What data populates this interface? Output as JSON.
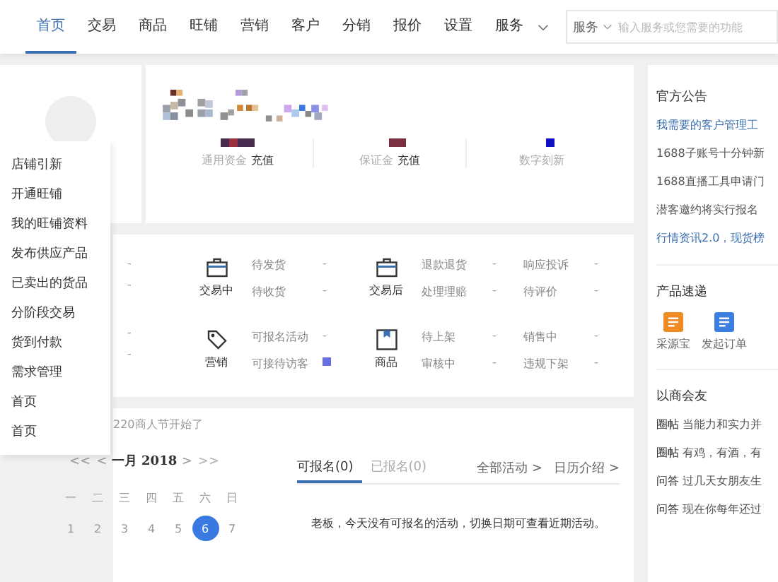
{
  "nav": {
    "items": [
      {
        "label": "首页",
        "selected": true
      },
      {
        "label": "交易",
        "selected": false
      },
      {
        "label": "商品",
        "selected": false
      },
      {
        "label": "旺铺",
        "selected": false
      },
      {
        "label": "营销",
        "selected": false
      },
      {
        "label": "客户",
        "selected": false
      },
      {
        "label": "分销",
        "selected": false
      },
      {
        "label": "报价",
        "selected": false
      },
      {
        "label": "设置",
        "selected": false
      },
      {
        "label": "服务",
        "selected": false
      }
    ],
    "search": {
      "scope": "服务",
      "placeholder": "输入服务或您需要的功能"
    }
  },
  "profile": {
    "funds": [
      {
        "label": "通用资金",
        "action": "充值"
      },
      {
        "label": "保证金",
        "action": "充值"
      },
      {
        "label": "数字刻新"
      }
    ]
  },
  "stats": {
    "groups": [
      {
        "kind": "bag",
        "title": "交易中",
        "items": [
          {
            "label": "待发货",
            "value": "-"
          },
          {
            "label": "待收货",
            "value": "-"
          }
        ]
      },
      {
        "kind": "bag",
        "title": "交易后",
        "items": [
          {
            "label": "退款退货",
            "value": "-"
          },
          {
            "label": "响应投诉",
            "value": "-"
          },
          {
            "label": "处理理赔",
            "value": "-"
          },
          {
            "label": "待评价",
            "value": "-"
          }
        ]
      },
      {
        "kind": "tag",
        "title": "营销",
        "items": [
          {
            "label": "可报名活动",
            "value": "-"
          },
          {
            "label": "可接待访客",
            "value": ""
          }
        ]
      },
      {
        "kind": "box",
        "title": "商品",
        "items": [
          {
            "label": "待上架",
            "value": "-"
          },
          {
            "label": "销售中",
            "value": "-"
          },
          {
            "label": "审核中",
            "value": "-"
          },
          {
            "label": "违规下架",
            "value": "-"
          }
        ]
      }
    ],
    "left_values": [
      "-",
      "-",
      "-",
      "-"
    ]
  },
  "dropdown": {
    "items": [
      "店铺引新",
      "开通旺铺",
      "我的旺铺资料",
      "发布供应产品",
      "已卖出的货品",
      "分阶段交易",
      "货到付款",
      "需求管理",
      "首页",
      "首页"
    ]
  },
  "activity": {
    "banner": "220商人节开始了",
    "calendar": {
      "prev": [
        "<<",
        "<"
      ],
      "month": "一月 2018",
      "next": [
        ">",
        ">>"
      ],
      "weekdays": [
        "一",
        "二",
        "三",
        "四",
        "五",
        "六",
        "日"
      ],
      "days": [
        {
          "label": "1",
          "selected": false
        },
        {
          "label": "2",
          "selected": false
        },
        {
          "label": "3",
          "selected": false
        },
        {
          "label": "4",
          "selected": false
        },
        {
          "label": "5",
          "selected": false
        },
        {
          "label": "6",
          "selected": true
        },
        {
          "label": "7",
          "selected": false
        }
      ]
    },
    "tabs": [
      {
        "label": "可报名(0)",
        "selected": true
      },
      {
        "label": "已报名(0)",
        "selected": false
      }
    ],
    "links": [
      "全部活动 >",
      "日历介绍 >"
    ],
    "message": "老板，今天没有可报名的活动，切换日期可查看近期活动。"
  },
  "sidebar": {
    "notice_title": "官方公告",
    "notices": [
      {
        "text": "我需要的客户管理工",
        "highlight": true
      },
      {
        "text": "1688子账号十分钟新",
        "highlight": false
      },
      {
        "text": "1688直播工具申请门",
        "highlight": false
      },
      {
        "text": "潜客邀约将实行报名",
        "highlight": false
      },
      {
        "text": "行情资讯2.0，现货榜",
        "highlight": true
      }
    ],
    "products_title": "产品速递",
    "products": [
      {
        "label": "采源宝",
        "color": "#f08a24"
      },
      {
        "label": "发起订单",
        "color": "#3d7fe0"
      }
    ],
    "community_title": "以商会友",
    "posts": [
      {
        "tag": "圈帖",
        "text": "当能力和实力并"
      },
      {
        "tag": "圈帖",
        "text": "有鸡，有酒，有"
      },
      {
        "tag": "问答",
        "text": "过几天女朋友生"
      },
      {
        "tag": "问答",
        "text": "现在你每年还过"
      }
    ]
  }
}
